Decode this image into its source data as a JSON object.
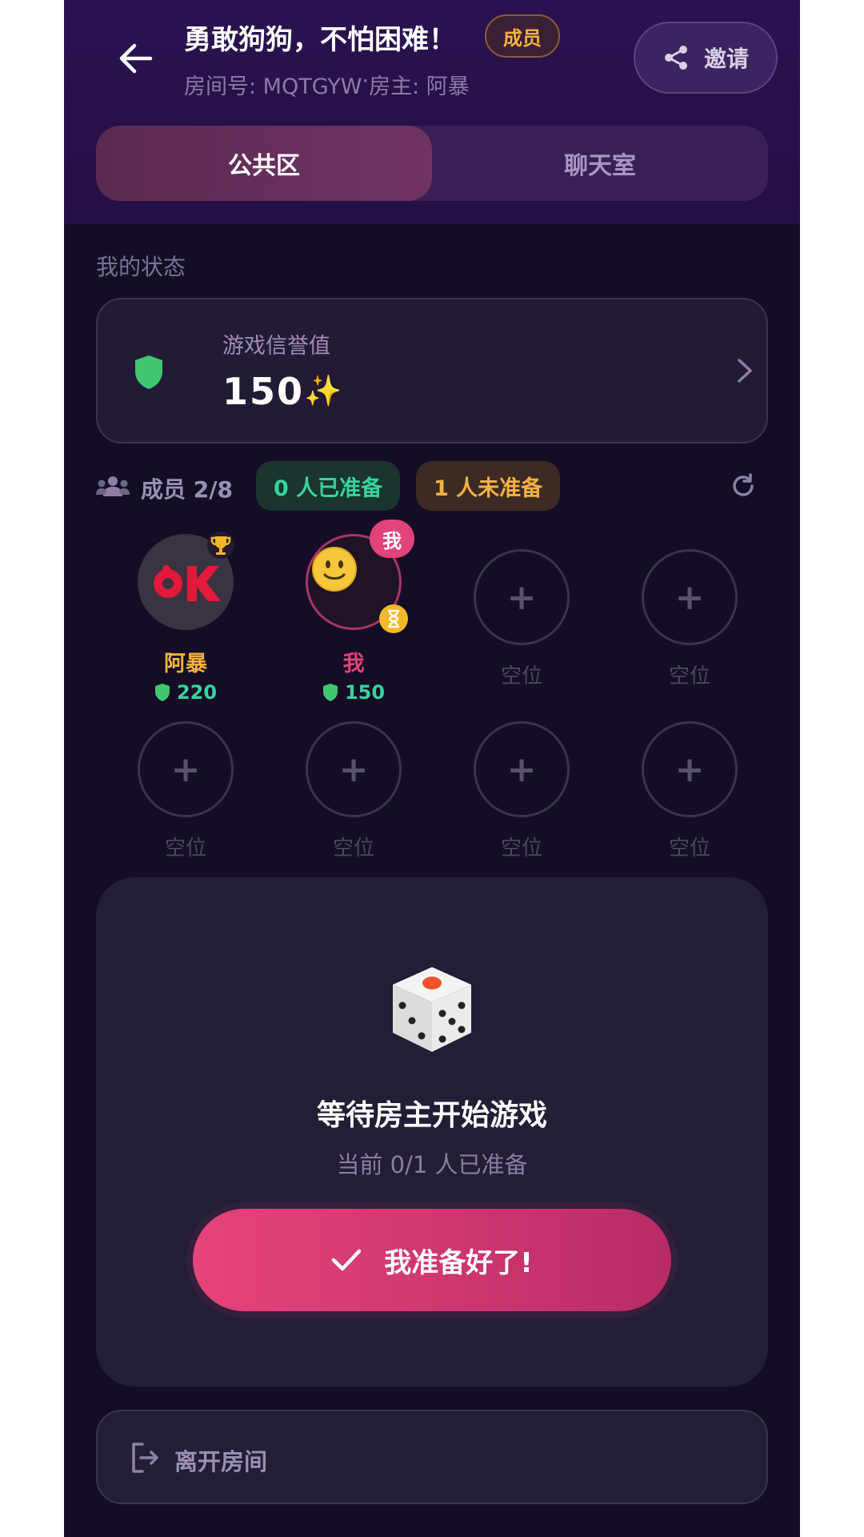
{
  "header": {
    "title": "勇敢狗狗，不怕困难！",
    "role_badge": "成员",
    "room_id_label": "房间号: MQTGYW",
    "separator": " · ",
    "owner_label": "房主: 阿暴",
    "invite_label": "邀请"
  },
  "tabs": [
    {
      "label": "公共区",
      "active": true
    },
    {
      "label": "聊天室",
      "active": false
    }
  ],
  "my_status": {
    "section_label": "我的状态",
    "credit_label": "游戏信誉值",
    "credit_value": "150",
    "credit_icon": "✨"
  },
  "members": {
    "count_label": "成员 2/8",
    "ready_label": "0 人已准备",
    "not_ready_label": "1 人未准备",
    "seats": [
      {
        "name": "阿暴",
        "score": "220",
        "host": true,
        "avatar_text": "OK"
      },
      {
        "name": "我",
        "score": "150",
        "me": true,
        "me_badge": "我",
        "avatar_emoji": "🙂"
      }
    ],
    "empty_label": "空位",
    "empty_plus": "+"
  },
  "waiting": {
    "title": "等待房主开始游戏",
    "subtitle": "当前 0/1 人已准备",
    "ready_button": "我准备好了!"
  },
  "leave": {
    "label": "离开房间"
  },
  "colors": {
    "background": "#150d25",
    "accent_pink": "#e6447a",
    "ready_green": "#38d39f",
    "not_ready_orange": "#f6b043"
  }
}
